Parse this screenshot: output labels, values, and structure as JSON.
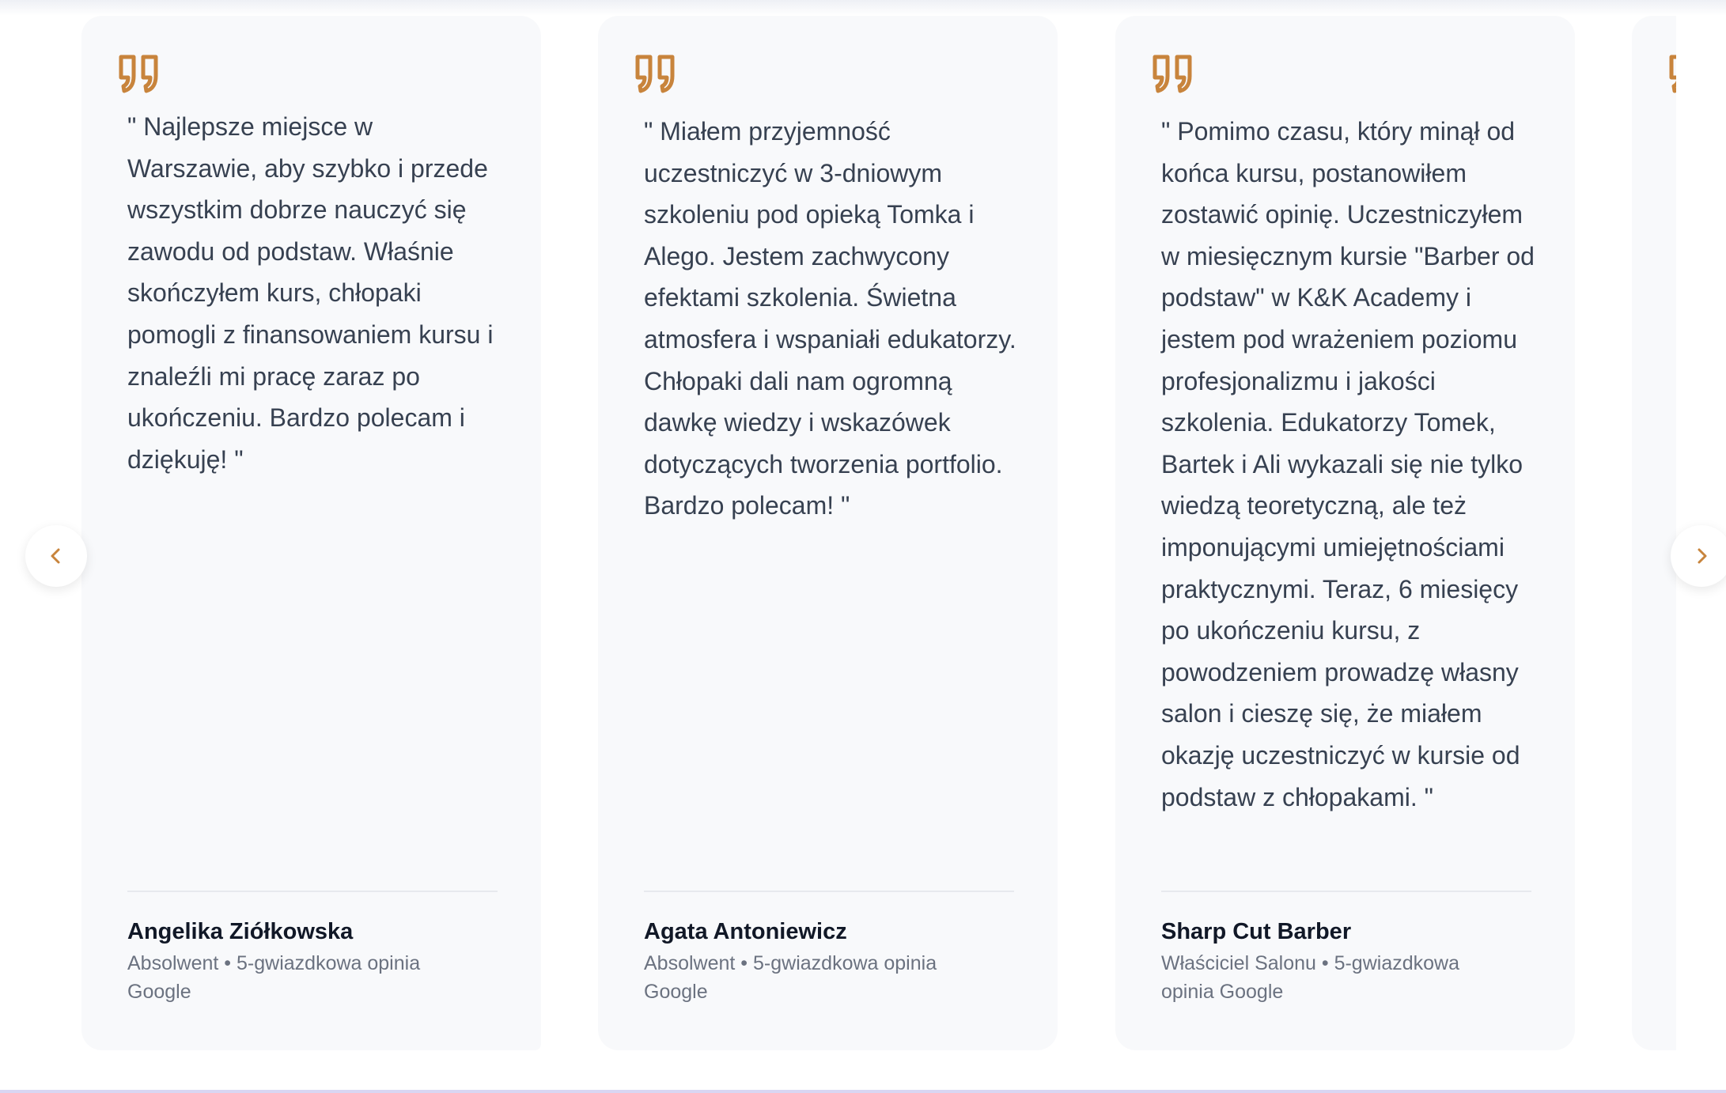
{
  "theme": {
    "accent": "#c8843c",
    "card_background": "#f8f9fb",
    "text": "#374151",
    "muted": "#6b7280"
  },
  "carousel": {
    "prev_icon": "chevron-left-icon",
    "next_icon": "chevron-right-icon",
    "quote_icon": "quote-icon",
    "testimonials": [
      {
        "quote": "\" Najlepsze miejsce w Warszawie, aby szybko i przede wszystkim dobrze nauczyć się zawodu od podstaw. Właśnie skończyłem kurs, chłopaki pomogli z finansowaniem kursu i znaleźli mi pracę zaraz po ukończeniu. Bardzo polecam i dziękuję! \"",
        "author": "Angelika Ziółkowska",
        "role": "Absolwent",
        "source": "5-gwiazdkowa opinia Google"
      },
      {
        "quote": "\" Miałem przyjemność uczestniczyć w 3-dniowym szkoleniu pod opieką Tomka i Alego. Jestem zachwycony efektami szkolenia. Świetna atmosfera i wspaniałi edukatorzy. Chłopaki dali nam ogromną dawkę wiedzy i wskazówek dotyczących tworzenia portfolio. Bardzo polecam! \"",
        "author": "Agata Antoniewicz",
        "role": "Absolwent",
        "source": "5-gwiazdkowa opinia Google"
      },
      {
        "quote": "\" Pomimo czasu, który minął od końca kursu, postanowiłem zostawić opinię. Uczestniczyłem w miesięcznym kursie \"Barber od podstaw\" w K&K Academy i jestem pod wrażeniem poziomu profesjonalizmu i jakości szkolenia. Edukatorzy Tomek, Bartek i Ali wykazali się nie tylko wiedzą teoretyczną, ale też imponującymi umiejętnościami praktycznymi. Teraz, 6 miesięcy po ukończeniu kursu, z powodzeniem prowadzę własny salon i cieszę się, że miałem okazję uczestniczyć w kursie od podstaw z chłopakami. \"",
        "author": "Sharp Cut Barber",
        "role": "Właściciel Salonu",
        "source": "5-gwiazdkowa opinia Google"
      }
    ]
  }
}
